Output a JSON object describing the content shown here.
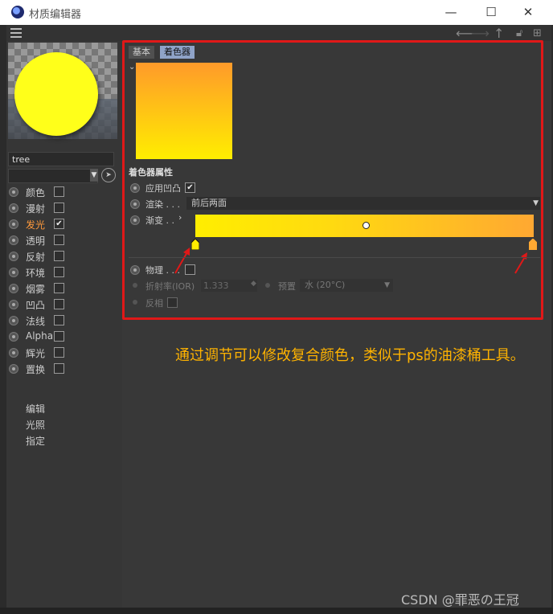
{
  "window": {
    "title": "材质编辑器",
    "minimize_glyph": "—",
    "maximize_glyph": "☐",
    "close_glyph": "✕"
  },
  "toolbar": {
    "icons": [
      "menu-icon",
      "back-arrow-icon",
      "forward-arrow-icon",
      "up-arrow-icon",
      "lock-icon",
      "new-window-icon"
    ]
  },
  "material": {
    "name": "tree",
    "channels": [
      {
        "label": "颜色",
        "checked": false,
        "active": false
      },
      {
        "label": "漫射",
        "checked": false,
        "active": false
      },
      {
        "label": "发光",
        "checked": true,
        "active": true
      },
      {
        "label": "透明",
        "checked": false,
        "active": false
      },
      {
        "label": "反射",
        "checked": false,
        "active": false
      },
      {
        "label": "环境",
        "checked": false,
        "active": false
      },
      {
        "label": "烟雾",
        "checked": false,
        "active": false
      },
      {
        "label": "凹凸",
        "checked": false,
        "active": false
      },
      {
        "label": "法线",
        "checked": false,
        "active": false
      },
      {
        "label": "Alpha",
        "checked": false,
        "active": false
      },
      {
        "label": "辉光",
        "checked": false,
        "active": false
      },
      {
        "label": "置换",
        "checked": false,
        "active": false
      }
    ],
    "extra_items": [
      "编辑",
      "光照",
      "指定"
    ]
  },
  "shader": {
    "tabs": [
      "基本",
      "着色器"
    ],
    "active_tab": "着色器",
    "section_title": "着色器属性",
    "use_bump_label": "应用凹凸",
    "use_bump_checked": true,
    "render_label": "渲染 . . .",
    "render_value": "前后两面",
    "gradient_label": "渐变 . .",
    "gradient_colors": [
      "#ffee00",
      "#ffa832"
    ],
    "physical_label": "物理 . . .",
    "ior_label": "折射率(IOR)",
    "ior_value": "1.333",
    "preset_label": "预置",
    "preset_value": "水 (20°C)",
    "invert_label": "反相"
  },
  "annotation": {
    "text": "通过调节可以修改复合颜色，类似于ps的油漆桶工具。"
  },
  "watermark": "CSDN @罪恶の王冠",
  "colors": {
    "highlight_box": "#e01818",
    "active_channel": "#ff9a3c",
    "annotation": "#ffb300",
    "preview_sphere": "#ffff1a"
  }
}
